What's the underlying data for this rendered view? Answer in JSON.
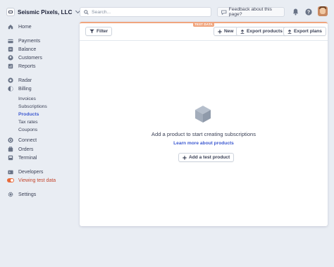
{
  "account": {
    "name": "Seismic Pixels, LLC"
  },
  "search": {
    "placeholder": "Search..."
  },
  "header": {
    "feedback_label": "Feedback about this page?"
  },
  "sidebar": {
    "items": [
      {
        "label": "Home"
      },
      {
        "label": "Payments"
      },
      {
        "label": "Balance"
      },
      {
        "label": "Customers"
      },
      {
        "label": "Reports"
      },
      {
        "label": "Radar"
      },
      {
        "label": "Billing"
      },
      {
        "label": "Invoices"
      },
      {
        "label": "Subscriptions"
      },
      {
        "label": "Products"
      },
      {
        "label": "Tax rates"
      },
      {
        "label": "Coupons"
      },
      {
        "label": "Connect"
      },
      {
        "label": "Orders"
      },
      {
        "label": "Terminal"
      },
      {
        "label": "Developers"
      },
      {
        "label": "Viewing test data"
      },
      {
        "label": "Settings"
      }
    ]
  },
  "toolbar": {
    "filter_label": "Filter",
    "test_badge": "TEST DATA",
    "new_label": "New",
    "export_products_label": "Export products",
    "export_plans_label": "Export plans"
  },
  "empty_state": {
    "title": "Add a product to start creating subscriptions",
    "link": "Learn more about products",
    "button_label": "Add a test product"
  },
  "colors": {
    "accent": "#3d5ad1",
    "test_mode": "#e86b3c",
    "background": "#e9edf3"
  }
}
